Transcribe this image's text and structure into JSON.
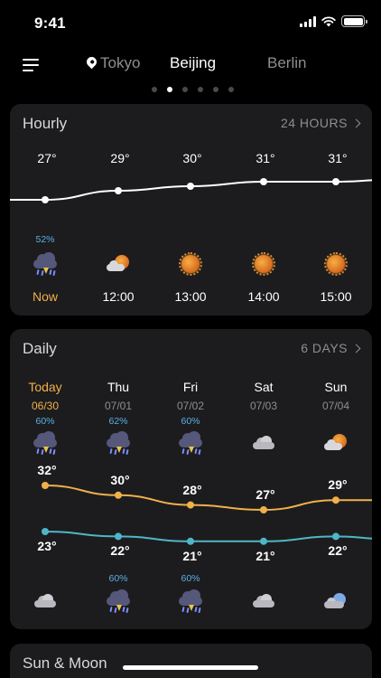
{
  "status_bar": {
    "time": "9:41"
  },
  "nav": {
    "cities": [
      {
        "name": "Tokyo",
        "state": "dim",
        "has_pin": true
      },
      {
        "name": "Beijing",
        "state": "active",
        "has_pin": false
      },
      {
        "name": "Berlin",
        "state": "dim",
        "has_pin": false
      }
    ],
    "page_count": 6,
    "active_page": 2
  },
  "hourly": {
    "title": "Hourly",
    "link_label": "24 HOURS",
    "items": [
      {
        "time": "Now",
        "temp": "27°",
        "precip": "52%",
        "icon": "thunderstorm-icon",
        "is_now": true
      },
      {
        "time": "12:00",
        "temp": "29°",
        "precip": "",
        "icon": "partly-cloudy-day-icon",
        "is_now": false
      },
      {
        "time": "13:00",
        "temp": "30°",
        "precip": "",
        "icon": "sunny-icon",
        "is_now": false
      },
      {
        "time": "14:00",
        "temp": "31°",
        "precip": "",
        "icon": "sunny-icon",
        "is_now": false
      },
      {
        "time": "15:00",
        "temp": "31°",
        "precip": "",
        "icon": "sunny-icon",
        "is_now": false
      }
    ],
    "temps_c": [
      27,
      29,
      30,
      31,
      31
    ]
  },
  "daily": {
    "title": "Daily",
    "link_label": "6 DAYS",
    "days": [
      {
        "name": "Today",
        "date": "06/30",
        "day_precip": "60%",
        "day_icon": "thunderstorm-icon",
        "high": "32°",
        "low": "23°",
        "night_precip": "",
        "night_icon": "cloudy-icon",
        "is_today": true
      },
      {
        "name": "Thu",
        "date": "07/01",
        "day_precip": "62%",
        "day_icon": "thunderstorm-icon",
        "high": "30°",
        "low": "22°",
        "night_precip": "60%",
        "night_icon": "thunderstorm-icon",
        "is_today": false
      },
      {
        "name": "Fri",
        "date": "07/02",
        "day_precip": "60%",
        "day_icon": "thunderstorm-icon",
        "high": "28°",
        "low": "21°",
        "night_precip": "60%",
        "night_icon": "thunderstorm-icon",
        "is_today": false
      },
      {
        "name": "Sat",
        "date": "07/03",
        "day_precip": "",
        "day_icon": "cloudy-icon",
        "high": "27°",
        "low": "21°",
        "night_precip": "",
        "night_icon": "cloudy-icon",
        "is_today": false
      },
      {
        "name": "Sun",
        "date": "07/04",
        "day_precip": "",
        "day_icon": "partly-cloudy-day-icon",
        "high": "29°",
        "low": "22°",
        "night_precip": "",
        "night_icon": "partly-cloudy-night-icon",
        "is_today": false
      }
    ],
    "high_c": [
      32,
      30,
      28,
      27,
      29
    ],
    "low_c": [
      23,
      22,
      21,
      21,
      22
    ],
    "colors": {
      "high_line": "#f0b04a",
      "low_line": "#4fb6c8"
    }
  },
  "sun_moon": {
    "title": "Sun & Moon"
  },
  "colors": {
    "background": "#000000",
    "card": "#1c1c1e",
    "accent": "#f0b04a",
    "precip": "#5ab0e6"
  }
}
